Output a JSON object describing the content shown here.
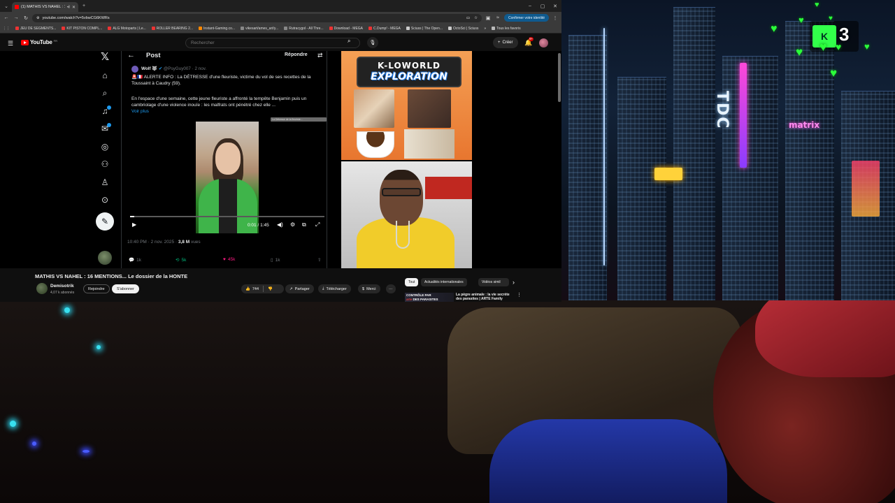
{
  "browser": {
    "tab_title": "(1) MATHIS VS NAHEL : 16 ...",
    "url": "youtube.com/watch?v=5vbwCG6KWRs",
    "verify_button": "Confirmer votre identité",
    "bookmarks": [
      "JEU DE SEGMENTS...",
      "KIT PISTON COMPL...",
      "ALG Motoparts | Le...",
      "ROLLER BEARING 2...",
      "Instant-Gaming.co...",
      "vikesart/ames_art/y...",
      "Rutracygol - All Thre...",
      "Download - MEGA",
      "C.Dump! - MEGA",
      "Sciuss | The Open...",
      "OctoSci | Sciuss"
    ],
    "bookmarks_all": "Tous les favoris"
  },
  "youtube": {
    "logo_text": "YouTube",
    "logo_region": "FR",
    "search_placeholder": "Rechercher",
    "create_label": "Créer",
    "notif_count": "9+"
  },
  "tweet": {
    "header_title": "Post",
    "reply_label": "Répondre",
    "author_name": "Wolf 🐺",
    "author_handle": "@PsyGuy007",
    "author_date": "· 2 nov.",
    "text_line1": "🚨🇫🇷 ALERTE INFO : La DÉTRESSE d'une fleuriste, victime du vol de ses recettes de la Toussaint à Caudry (59).",
    "text_line2": "En l'espace d'une semaine, cette jeune fleuriste a affronté la tempête Benjamin puis un cambriolage d'une violence inouïe : les malfrats ont pénétré chez elle ...",
    "see_more": "Voir plus",
    "video_caption_chip": "La Détresse de la fleuriste...",
    "progress": 0.01,
    "time": "0:01 / 1:45",
    "posted": "10:40 PM · 2 nov. 2025 · ",
    "views_value": "3,8 M",
    "views_label": " vues",
    "replies": "1k",
    "reposts": "5k",
    "likes": "45k",
    "bookmarks": "1k"
  },
  "reaction": {
    "banner_line1": "K-LOWORLD",
    "banner_line2": "EXPLORATION"
  },
  "video": {
    "title": "MATHIS VS NAHEL : 16 MENTIONS... Le dossier de la HONTE",
    "channel": "Demisotrik",
    "subscribers": "4,07 k abonnés",
    "join": "Rejoindre",
    "subscribe": "S'abonner",
    "likes": "744",
    "share": "Partager",
    "download": "Télécharger",
    "thanks": "Merci",
    "more": "···"
  },
  "sidebar_chips": [
    "Tout",
    "Actualités internationales",
    "Vidéos simil"
  ],
  "recommendation": {
    "thumb_line1": "CONTRÔLE PAR",
    "thumb_brand": "arte",
    "thumb_line2": "DES PARASITES",
    "title": "La pègre animale : la vie secrète des parasites | ARTE Family"
  },
  "overlay": {
    "counter": "3",
    "city_sign": "TDC",
    "neon_sign": "matrix"
  },
  "colors": {
    "youtube_red": "#ff0000",
    "x_blue": "#1d9bf0",
    "like_pink": "#f91880",
    "repost_green": "#00ba7c",
    "heart_green": "#2bff3a"
  }
}
